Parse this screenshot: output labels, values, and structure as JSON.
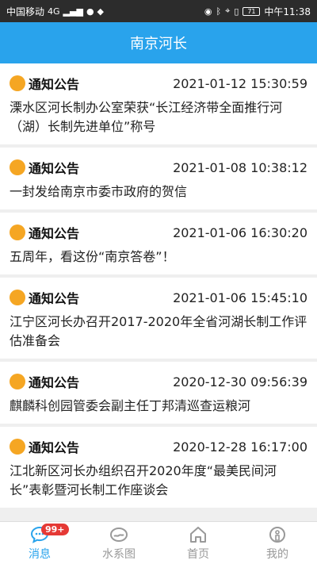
{
  "statusbar": {
    "carrier": "中国移动",
    "network": "4G",
    "time": "中午11:38",
    "battery": "71"
  },
  "appbar": {
    "title": "南京河长"
  },
  "notices": [
    {
      "tag": "通知公告",
      "date": "2021-01-12 15:30:59",
      "title": "溧水区河长制办公室荣获“长江经济带全面推行河（湖）长制先进单位”称号"
    },
    {
      "tag": "通知公告",
      "date": "2021-01-08 10:38:12",
      "title": "一封发给南京市委市政府的贺信"
    },
    {
      "tag": "通知公告",
      "date": "2021-01-06 16:30:20",
      "title": "五周年，看这份“南京答卷”！"
    },
    {
      "tag": "通知公告",
      "date": "2021-01-06 15:45:10",
      "title": "江宁区河长办召开2017-2020年全省河湖长制工作评估准备会"
    },
    {
      "tag": "通知公告",
      "date": "2020-12-30 09:56:39",
      "title": "麒麟科创园管委会副主任丁邦清巡查运粮河"
    },
    {
      "tag": "通知公告",
      "date": "2020-12-28 16:17:00",
      "title": "江北新区河长办组织召开2020年度“最美民间河长”表彰暨河长制工作座谈会"
    }
  ],
  "tabbar": {
    "messages": "消息",
    "badge": "99+",
    "water": "水系图",
    "home": "首页",
    "mine": "我的"
  },
  "colors": {
    "accent": "#29a3ec",
    "dot": "#f5a623",
    "badge": "#e53935"
  }
}
